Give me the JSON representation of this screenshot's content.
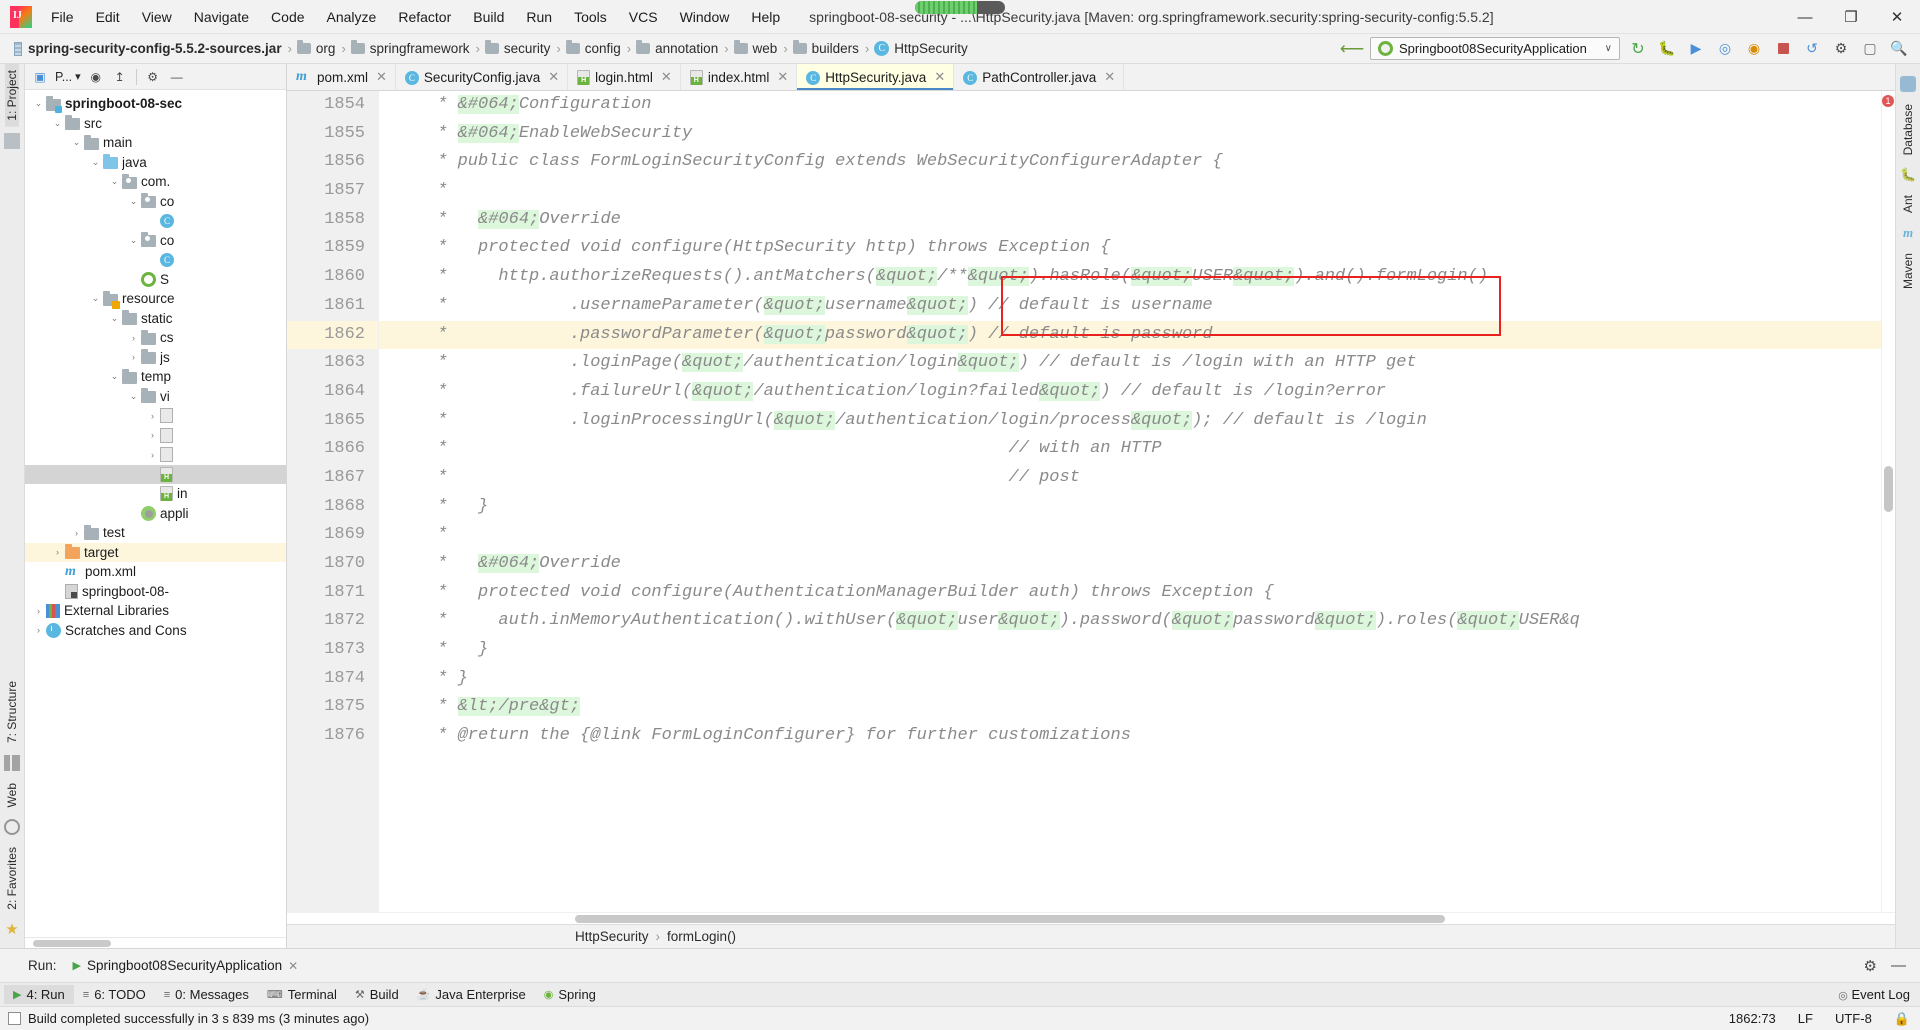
{
  "titlebar": {
    "menus": [
      "File",
      "Edit",
      "View",
      "Navigate",
      "Code",
      "Analyze",
      "Refactor",
      "Build",
      "Run",
      "Tools",
      "VCS",
      "Window",
      "Help"
    ],
    "window_title": "springboot-08-security - ...\\HttpSecurity.java [Maven: org.springframework.security:spring-security-config:5.5.2]",
    "minimize": "—",
    "maximize": "❐",
    "close": "✕"
  },
  "navbar": {
    "breadcrumbs": [
      {
        "label": "spring-security-config-5.5.2-sources.jar",
        "icon": "jar-icon",
        "bold": true
      },
      {
        "label": "org",
        "icon": "folder-icon",
        "bold": false
      },
      {
        "label": "springframework",
        "icon": "folder-icon",
        "bold": false
      },
      {
        "label": "security",
        "icon": "folder-icon",
        "bold": false
      },
      {
        "label": "config",
        "icon": "folder-icon",
        "bold": false
      },
      {
        "label": "annotation",
        "icon": "folder-icon",
        "bold": false
      },
      {
        "label": "web",
        "icon": "folder-icon",
        "bold": false
      },
      {
        "label": "builders",
        "icon": "folder-icon",
        "bold": false
      },
      {
        "label": "HttpSecurity",
        "icon": "class-icon",
        "bold": false
      }
    ],
    "run_config": "Springboot08SecurityApplication",
    "caret": "∨",
    "icons": [
      "build-icon",
      "debug-icon",
      "coverage-icon",
      "profiler-icon",
      "run-with-icon",
      "stop-icon",
      "update-icon",
      "ide-settings-icon",
      "search-everywhere-icon"
    ]
  },
  "project_panel": {
    "selector_label": "P...",
    "toolbar_icons": [
      "project-view-icon",
      "scope-icon",
      "locate-icon",
      "collapse-all-icon",
      "settings-gear-icon"
    ],
    "tree": [
      {
        "depth": 0,
        "twist": "⌄",
        "icon": "module-folder-icon",
        "label": "springboot-08-sec",
        "bold": true,
        "state": "none"
      },
      {
        "depth": 1,
        "twist": "⌄",
        "icon": "folder-icon",
        "label": "src",
        "bold": false,
        "state": "none"
      },
      {
        "depth": 2,
        "twist": "⌄",
        "icon": "folder-icon",
        "label": "main",
        "bold": false,
        "state": "none"
      },
      {
        "depth": 3,
        "twist": "⌄",
        "icon": "source-folder-icon",
        "label": "java",
        "bold": false,
        "state": "none"
      },
      {
        "depth": 4,
        "twist": "⌄",
        "icon": "package-icon",
        "label": "com.",
        "bold": false,
        "state": "none"
      },
      {
        "depth": 5,
        "twist": "⌄",
        "icon": "package-icon",
        "label": "co",
        "bold": false,
        "state": "none"
      },
      {
        "depth": 6,
        "twist": "",
        "icon": "class-icon",
        "label": "",
        "bold": false,
        "state": "none"
      },
      {
        "depth": 5,
        "twist": "⌄",
        "icon": "package-icon",
        "label": "co",
        "bold": false,
        "state": "none"
      },
      {
        "depth": 6,
        "twist": "",
        "icon": "class-icon",
        "label": "",
        "bold": false,
        "state": "none"
      },
      {
        "depth": 5,
        "twist": "",
        "icon": "spring-app-icon",
        "label": "S",
        "bold": false,
        "state": "none"
      },
      {
        "depth": 3,
        "twist": "⌄",
        "icon": "resources-folder-icon",
        "label": "resource",
        "bold": false,
        "state": "none"
      },
      {
        "depth": 4,
        "twist": "⌄",
        "icon": "folder-icon",
        "label": "static",
        "bold": false,
        "state": "none"
      },
      {
        "depth": 5,
        "twist": "›",
        "icon": "folder-icon",
        "label": "cs",
        "bold": false,
        "state": "none"
      },
      {
        "depth": 5,
        "twist": "›",
        "icon": "folder-icon",
        "label": "js",
        "bold": false,
        "state": "none"
      },
      {
        "depth": 4,
        "twist": "⌄",
        "icon": "folder-icon",
        "label": "temp",
        "bold": false,
        "state": "none"
      },
      {
        "depth": 5,
        "twist": "⌄",
        "icon": "folder-icon",
        "label": "vi",
        "bold": false,
        "state": "none"
      },
      {
        "depth": 6,
        "twist": "›",
        "icon": "file-icon",
        "label": "",
        "bold": false,
        "state": "none"
      },
      {
        "depth": 6,
        "twist": "›",
        "icon": "file-icon",
        "label": "",
        "bold": false,
        "state": "none"
      },
      {
        "depth": 6,
        "twist": "›",
        "icon": "file-icon",
        "label": "",
        "bold": false,
        "state": "none"
      },
      {
        "depth": 6,
        "twist": "",
        "icon": "html-icon",
        "label": "",
        "bold": false,
        "state": "sel-gray"
      },
      {
        "depth": 6,
        "twist": "",
        "icon": "html-icon",
        "label": "in",
        "bold": false,
        "state": "none"
      },
      {
        "depth": 5,
        "twist": "",
        "icon": "yaml-icon",
        "label": "appli",
        "bold": false,
        "state": "none"
      },
      {
        "depth": 2,
        "twist": "›",
        "icon": "folder-icon",
        "label": "test",
        "bold": false,
        "state": "none"
      },
      {
        "depth": 1,
        "twist": "›",
        "icon": "target-folder-icon",
        "label": "target",
        "bold": false,
        "state": "sel-yellow"
      },
      {
        "depth": 1,
        "twist": "",
        "icon": "maven-icon",
        "label": "pom.xml",
        "bold": false,
        "state": "none"
      },
      {
        "depth": 1,
        "twist": "",
        "icon": "iml-icon",
        "label": "springboot-08-",
        "bold": false,
        "state": "none"
      },
      {
        "depth": 0,
        "twist": "›",
        "icon": "external-libraries-icon",
        "label": "External Libraries",
        "bold": false,
        "state": "none"
      },
      {
        "depth": 0,
        "twist": "›",
        "icon": "scratches-icon",
        "label": "Scratches and Cons",
        "bold": false,
        "state": "none"
      }
    ]
  },
  "left_rail": {
    "top": "1: Project",
    "middle": "7: Structure",
    "bottom": "2: Favorites",
    "web": "Web"
  },
  "right_rail": {
    "items": [
      "Database",
      "Ant",
      "Maven"
    ]
  },
  "editor": {
    "tabs": [
      {
        "label": "pom.xml",
        "icon": "maven-icon",
        "active": false
      },
      {
        "label": "SecurityConfig.java",
        "icon": "class-icon",
        "active": false
      },
      {
        "label": "login.html",
        "icon": "html-icon",
        "active": false
      },
      {
        "label": "index.html",
        "icon": "html-icon",
        "active": false
      },
      {
        "label": "HttpSecurity.java",
        "icon": "class-icon",
        "active": true
      },
      {
        "label": "PathController.java",
        "icon": "class-icon",
        "active": false
      }
    ],
    "close_glyph": "✕",
    "first_line_number": 1854,
    "current_line": 1862,
    "lines": [
      {
        "n": 1854,
        "segments": [
          {
            "t": " * ",
            "h": false
          },
          {
            "t": "&#064;",
            "h": true
          },
          {
            "t": "Configuration",
            "h": false
          }
        ]
      },
      {
        "n": 1855,
        "segments": [
          {
            "t": " * ",
            "h": false
          },
          {
            "t": "&#064;",
            "h": true
          },
          {
            "t": "EnableWebSecurity",
            "h": false
          }
        ]
      },
      {
        "n": 1856,
        "segments": [
          {
            "t": " * public class FormLoginSecurityConfig extends WebSecurityConfigurerAdapter {",
            "h": false
          }
        ]
      },
      {
        "n": 1857,
        "segments": [
          {
            "t": " *",
            "h": false
          }
        ]
      },
      {
        "n": 1858,
        "segments": [
          {
            "t": " *   ",
            "h": false
          },
          {
            "t": "&#064;",
            "h": true
          },
          {
            "t": "Override",
            "h": false
          }
        ]
      },
      {
        "n": 1859,
        "segments": [
          {
            "t": " *   protected void configure(HttpSecurity http) throws Exception {",
            "h": false
          }
        ]
      },
      {
        "n": 1860,
        "segments": [
          {
            "t": " *     http.authorizeRequests().antMatchers(",
            "h": false
          },
          {
            "t": "&quot;",
            "h": true
          },
          {
            "t": "/**",
            "h": false
          },
          {
            "t": "&quot;",
            "h": true
          },
          {
            "t": ").hasRole(",
            "h": false
          },
          {
            "t": "&quot;",
            "h": true
          },
          {
            "t": "USER",
            "h": false
          },
          {
            "t": "&quot;",
            "h": true
          },
          {
            "t": ").and().formLogin()",
            "h": false
          }
        ]
      },
      {
        "n": 1861,
        "segments": [
          {
            "t": " *            .usernameParameter(",
            "h": false
          },
          {
            "t": "&quot;",
            "h": true
          },
          {
            "t": "username",
            "h": false
          },
          {
            "t": "&quot;",
            "h": true
          },
          {
            "t": ") // default is username",
            "h": false
          }
        ]
      },
      {
        "n": 1862,
        "segments": [
          {
            "t": " *            .passwordParameter(",
            "h": false
          },
          {
            "t": "&quot;",
            "h": true
          },
          {
            "t": "password",
            "h": false
          },
          {
            "t": "&quot;",
            "h": true
          },
          {
            "t": ") // default is password",
            "h": false
          }
        ]
      },
      {
        "n": 1863,
        "segments": [
          {
            "t": " *            .loginPage(",
            "h": false
          },
          {
            "t": "&quot;",
            "h": true
          },
          {
            "t": "/authentication/login",
            "h": false
          },
          {
            "t": "&quot;",
            "h": true
          },
          {
            "t": ") // default is /login with an HTTP get",
            "h": false
          }
        ]
      },
      {
        "n": 1864,
        "segments": [
          {
            "t": " *            .failureUrl(",
            "h": false
          },
          {
            "t": "&quot;",
            "h": true
          },
          {
            "t": "/authentication/login?failed",
            "h": false
          },
          {
            "t": "&quot;",
            "h": true
          },
          {
            "t": ") // default is /login?error",
            "h": false
          }
        ]
      },
      {
        "n": 1865,
        "segments": [
          {
            "t": " *            .loginProcessingUrl(",
            "h": false
          },
          {
            "t": "&quot;",
            "h": true
          },
          {
            "t": "/authentication/login/process",
            "h": false
          },
          {
            "t": "&quot;",
            "h": true
          },
          {
            "t": "); // default is /login",
            "h": false
          }
        ]
      },
      {
        "n": 1866,
        "segments": [
          {
            "t": " *                                                       // with an HTTP",
            "h": false
          }
        ]
      },
      {
        "n": 1867,
        "segments": [
          {
            "t": " *                                                       // post",
            "h": false
          }
        ]
      },
      {
        "n": 1868,
        "segments": [
          {
            "t": " *   }",
            "h": false
          }
        ]
      },
      {
        "n": 1869,
        "segments": [
          {
            "t": " *",
            "h": false
          }
        ]
      },
      {
        "n": 1870,
        "segments": [
          {
            "t": " *   ",
            "h": false
          },
          {
            "t": "&#064;",
            "h": true
          },
          {
            "t": "Override",
            "h": false
          }
        ]
      },
      {
        "n": 1871,
        "segments": [
          {
            "t": " *   protected void configure(AuthenticationManagerBuilder auth) throws Exception {",
            "h": false
          }
        ]
      },
      {
        "n": 1872,
        "segments": [
          {
            "t": " *     auth.inMemoryAuthentication().withUser(",
            "h": false
          },
          {
            "t": "&quot;",
            "h": true
          },
          {
            "t": "user",
            "h": false
          },
          {
            "t": "&quot;",
            "h": true
          },
          {
            "t": ").password(",
            "h": false
          },
          {
            "t": "&quot;",
            "h": true
          },
          {
            "t": "password",
            "h": false
          },
          {
            "t": "&quot;",
            "h": true
          },
          {
            "t": ").roles(",
            "h": false
          },
          {
            "t": "&quot;",
            "h": true
          },
          {
            "t": "USER&q",
            "h": false
          }
        ]
      },
      {
        "n": 1873,
        "segments": [
          {
            "t": " *   }",
            "h": false
          }
        ]
      },
      {
        "n": 1874,
        "segments": [
          {
            "t": " * }",
            "h": false
          }
        ]
      },
      {
        "n": 1875,
        "segments": [
          {
            "t": " * ",
            "h": false
          },
          {
            "t": "&lt;/pre&gt;",
            "h": true
          }
        ]
      },
      {
        "n": 1876,
        "segments": [
          {
            "t": " * @return the {@link FormLoginConfigurer} for further customizations",
            "h": false
          }
        ]
      }
    ],
    "crumbs": [
      "HttpSecurity",
      "formLogin()"
    ],
    "crumb_sep": "›",
    "error_badge": "1"
  },
  "run_panel": {
    "label": "Run:",
    "tab": "Springboot08SecurityApplication",
    "close_glyph": "✕",
    "settings_icon": "gear-icon",
    "minimize_icon": "minimize-icon"
  },
  "tool_strip": {
    "items": [
      {
        "label": "4: Run",
        "mnemonic": "4",
        "active": true,
        "icon": "run-icon"
      },
      {
        "label": "6: TODO",
        "mnemonic": "6",
        "active": false,
        "icon": "todo-icon"
      },
      {
        "label": "0: Messages",
        "mnemonic": "0",
        "active": false,
        "icon": "messages-icon"
      },
      {
        "label": "Terminal",
        "mnemonic": "",
        "active": false,
        "icon": "terminal-icon"
      },
      {
        "label": "Build",
        "mnemonic": "",
        "active": false,
        "icon": "build-icon"
      },
      {
        "label": "Java Enterprise",
        "mnemonic": "",
        "active": false,
        "icon": "java-enterprise-icon"
      },
      {
        "label": "Spring",
        "mnemonic": "",
        "active": false,
        "icon": "spring-icon"
      }
    ],
    "event_log": "Event Log"
  },
  "statusbar": {
    "message": "Build completed successfully in 3 s 839 ms (3 minutes ago)",
    "caret_position": "1862:73",
    "line_separator": "LF",
    "encoding": "UTF-8",
    "lock_icon": "lock-icon"
  },
  "colors": {
    "accent_blue": "#4a88c7",
    "highlight_green": "#ddf7dd",
    "current_line_yellow": "#fdf6dd",
    "red_box": "#e8231f",
    "spring_green": "#6db33f"
  }
}
